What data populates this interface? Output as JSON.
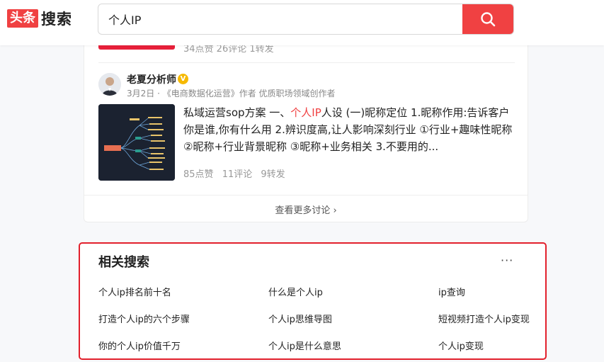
{
  "logo": {
    "box_text": "头条",
    "text": "搜索"
  },
  "search": {
    "value": "个人IP"
  },
  "partial_post": {
    "stats": "34点赞  26评论  1转发"
  },
  "post": {
    "author": "老夏分析师",
    "verified_badge": "V",
    "meta": "3月2日 · 《电商数据化运营》作者 优质职场领域创作者",
    "content_prefix": "私域运营sop方案 一、",
    "content_highlight": "个人IP",
    "content_suffix": "人设 (一)昵称定位 1.昵称作用:告诉客户你是谁,你有什么用 2.辨识度高,让人影响深刻行业 ①行业+趣味性昵称 ②昵称+行业背景昵称 ③昵称+业务相关 3.不要用的...",
    "likes": "85点赞",
    "comments": "11评论",
    "shares": "9转发"
  },
  "more_link": "查看更多讨论 ›",
  "related": {
    "title": "相关搜索",
    "more": "···",
    "items": [
      "个人ip排名前十名",
      "什么是个人ip",
      "ip查询",
      "打造个人ip的六个步骤",
      "个人ip思维导图",
      "短视频打造个人ip变现",
      "你的个人ip价值千万",
      "个人ip是什么意思",
      "个人ip变现"
    ]
  },
  "colors": {
    "brand": "#f04142",
    "highlight_border": "#e2202c",
    "verified": "#f6b900"
  }
}
